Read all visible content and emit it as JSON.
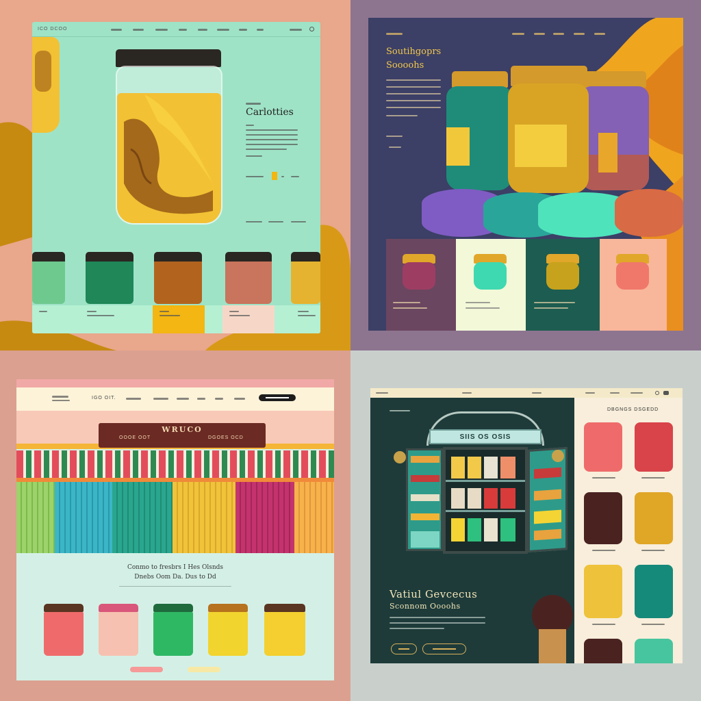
{
  "q1": {
    "brand": "ICO DCOO",
    "heading": "Carlotties",
    "colors": {
      "bg": "#9fe3c7",
      "jar": "#f3c134",
      "accent": "#f3b612"
    }
  },
  "q2": {
    "heading_line1": "Soutihgoprs",
    "heading_line2": "Soooohs",
    "colors": {
      "bg": "#3c3f66",
      "jar_green": "#1f8c79",
      "jar_yellow": "#d9a424",
      "jar_purple": "#8461b5"
    }
  },
  "q3": {
    "nav_brand": "IGO OIT.",
    "sign_line1": "WRUCO",
    "sign_line2": "OOOE OOT",
    "sign_line3": "DGOES OCD",
    "tagline_line1": "Conmo to fresbrs I Hes Olsnds",
    "tagline_line2": "Dnebs Oom Da. Dus to Dd",
    "colors": {
      "bg": "#d4f0e6",
      "header": "#fdf3d9",
      "awning_red": "#e34d5b",
      "awning_green": "#2f8a52"
    }
  },
  "q4": {
    "shop_sign": "SIIS OS OSIS",
    "heading_line1": "Vatiul Gevcecus",
    "heading_line2": "Sconnom Oooohs",
    "side_heading": "DBGNGS DSGEDD",
    "colors": {
      "bg": "#1e3b3a",
      "side": "#f8eedb"
    }
  }
}
